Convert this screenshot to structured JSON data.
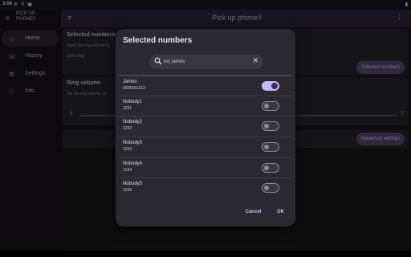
{
  "status_bar": {
    "time": "3:06",
    "icons": "⚙ ⚲ ▣"
  },
  "drawer": {
    "title": "PICK UP PHONE!!",
    "items": [
      {
        "label": "Home",
        "icon": "home-icon",
        "active": true
      },
      {
        "label": "History",
        "icon": "phone-history-icon",
        "active": false
      },
      {
        "label": "Settings",
        "icon": "gear-icon",
        "active": false
      },
      {
        "label": "Info",
        "icon": "info-icon",
        "active": false
      }
    ]
  },
  "app_bar": {
    "title": "Pick up phone!!"
  },
  "background": {
    "card1": {
      "title": "Selected numbers",
      "text1": "Apply the ring volume to",
      "text2": "(selected)",
      "button": "Selected numbers"
    },
    "card2": {
      "title": "Ring volume",
      "text": "Set the ring volume to",
      "min": "0",
      "max": "7"
    },
    "card3": {
      "button": "Advanced settings"
    }
  },
  "dialog": {
    "title": "Selected numbers",
    "search_placeholder": "ex) james",
    "contacts": [
      {
        "name": "James",
        "number": "6505551212",
        "selected": true
      },
      {
        "name": "Nobody1",
        "number": "1231",
        "selected": false
      },
      {
        "name": "Nobody2",
        "number": "1232",
        "selected": false
      },
      {
        "name": "Nobody3",
        "number": "1233",
        "selected": false
      },
      {
        "name": "Nobody4",
        "number": "1234",
        "selected": false
      },
      {
        "name": "Nobody5",
        "number": "1235",
        "selected": false
      }
    ],
    "cancel_label": "Cancel",
    "ok_label": "OK"
  },
  "colors": {
    "accent": "#c9b6f7",
    "app_bar": "#2f2741",
    "dialog_bg": "#2b2930"
  }
}
